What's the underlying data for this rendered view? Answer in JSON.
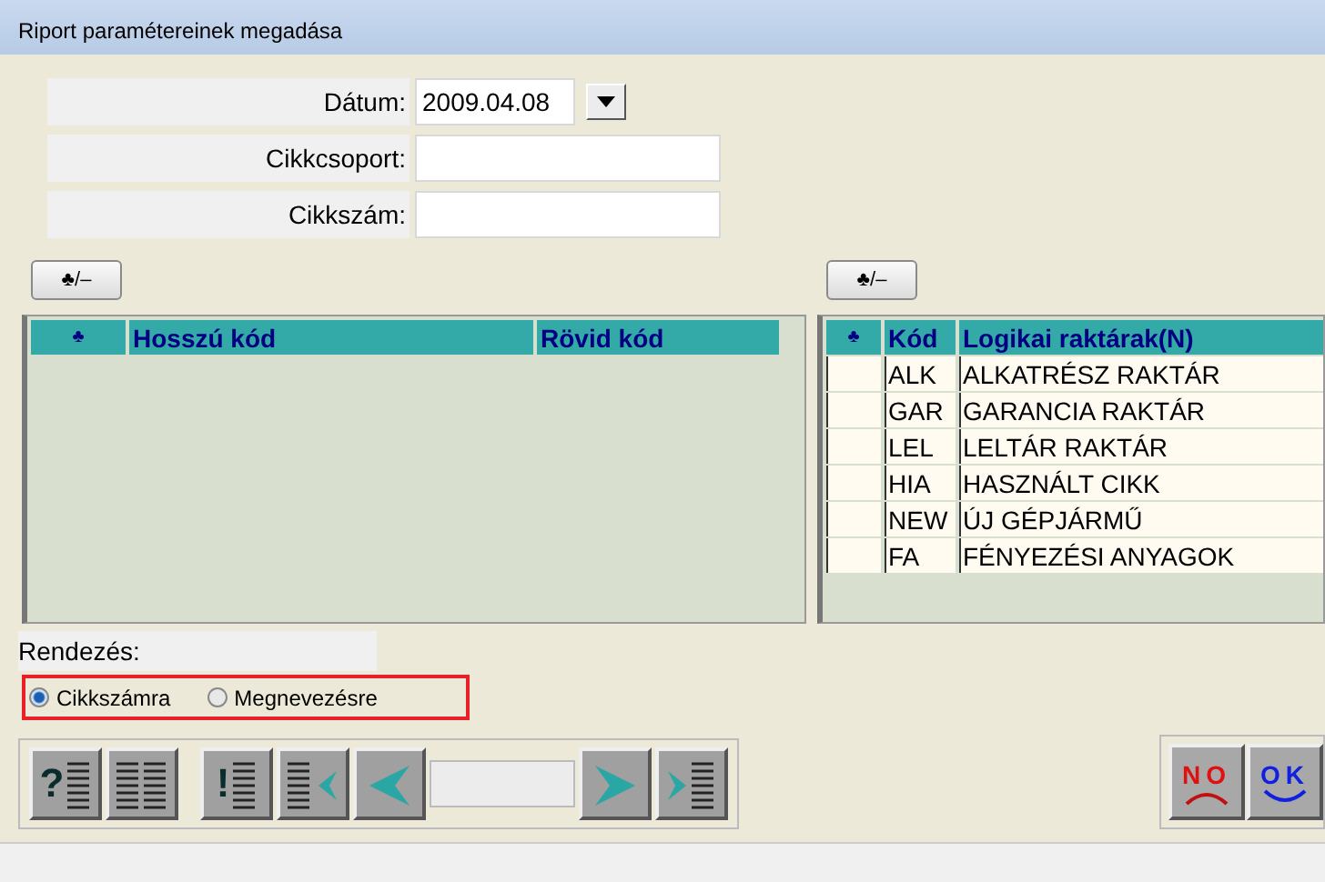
{
  "window": {
    "title": "Riport paramétereinek megadása"
  },
  "form": [
    {
      "label": "Dátum:",
      "kind": "date",
      "value": "2009.04.08"
    },
    {
      "label": "Cikkcsoport:",
      "kind": "text"
    },
    {
      "label": "Cikkszám:",
      "kind": "text"
    }
  ],
  "left_panel": {
    "toggle": "♣/–",
    "columns": [
      "♣",
      "Hosszú kód",
      "Rövid kód"
    ]
  },
  "right_panel": {
    "toggle": "♣/–",
    "columns": [
      "♣",
      "Kód",
      "Logikai raktárak(N)"
    ],
    "rows": [
      {
        "code": "ALK",
        "name": "ALKATRÉSZ RAKTÁR"
      },
      {
        "code": "GAR",
        "name": "GARANCIA RAKTÁR"
      },
      {
        "code": "LEL",
        "name": "LELTÁR RAKTÁR"
      },
      {
        "code": "HIA",
        "name": "HASZNÁLT CIKK"
      },
      {
        "code": "NEW",
        "name": "ÚJ GÉPJÁRMŰ"
      },
      {
        "code": "FA",
        "name": "FÉNYEZÉSI ANYAGOK"
      }
    ]
  },
  "sort": {
    "label": "Rendezés:",
    "options": [
      {
        "label": "Cikkszámra",
        "selected": true
      },
      {
        "label": "Megnevezésre",
        "selected": false
      }
    ]
  },
  "toolbar": [
    {
      "kind": "query",
      "glyph": "?"
    },
    {
      "kind": "list"
    },
    {
      "kind": "filter",
      "glyph": "!"
    },
    {
      "kind": "first"
    },
    {
      "kind": "prev"
    },
    {
      "kind": "field"
    },
    {
      "kind": "next"
    },
    {
      "kind": "last"
    }
  ],
  "actions": [
    {
      "kind": "cancel",
      "label": "NO"
    },
    {
      "kind": "ok",
      "label": "OK"
    }
  ]
}
